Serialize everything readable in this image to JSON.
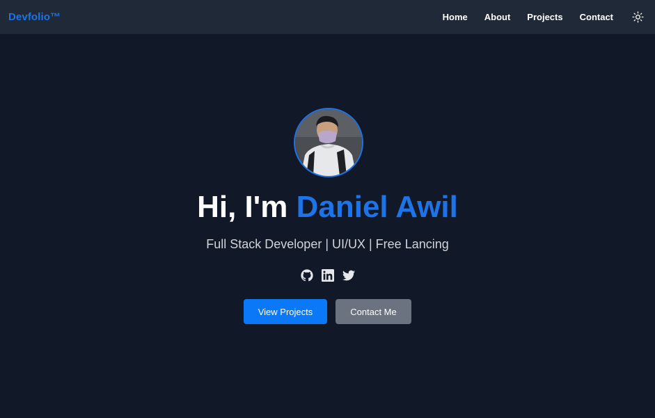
{
  "brand": "Devfolio™",
  "nav": {
    "items": [
      "Home",
      "About",
      "Projects",
      "Contact"
    ],
    "theme_icon": "sun-icon"
  },
  "hero": {
    "greeting": "Hi, I'm",
    "name": "Daniel Awil",
    "tagline": "Full Stack Developer | UI/UX | Free Lancing",
    "socials": [
      "github-icon",
      "linkedin-icon",
      "twitter-icon"
    ],
    "primary_button": "View Projects",
    "secondary_button": "Contact Me"
  },
  "colors": {
    "background": "#111827",
    "navbar": "#1f2937",
    "accent": "#1d74e8",
    "primary_button": "#0b79f7",
    "secondary_button": "#6b7280"
  }
}
